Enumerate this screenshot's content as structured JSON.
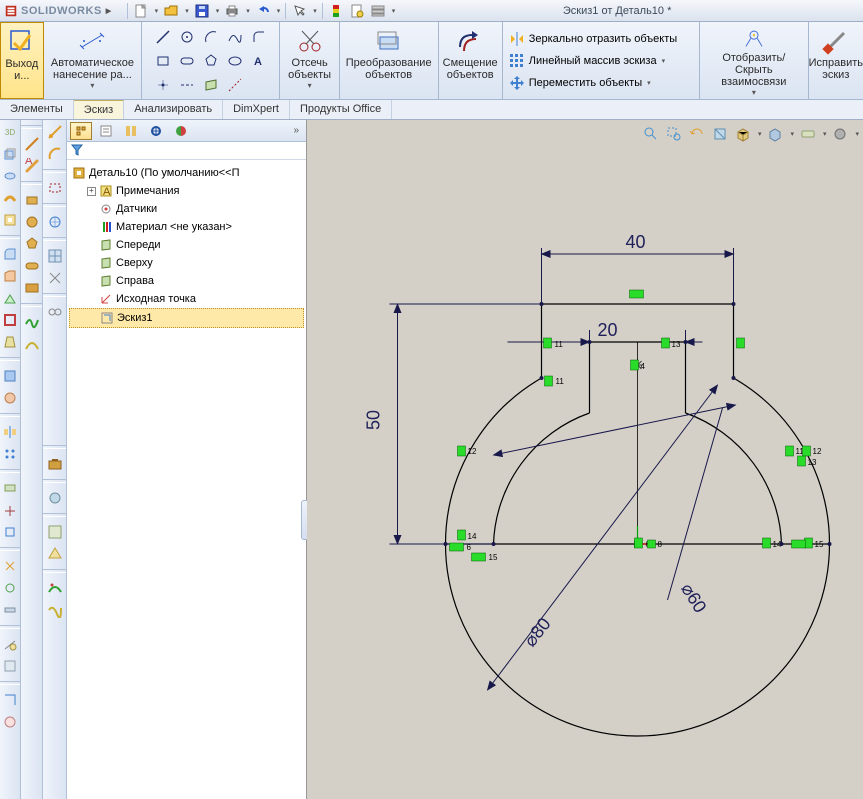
{
  "title": "Эскиз1 от Деталь10 *",
  "logo": "SOLIDWORKS",
  "ribbon": {
    "exit": "Выход и...",
    "autodim": "Автоматическое нанесение ра...",
    "trim": "Отсечь объекты",
    "convert": "Преобразование объектов",
    "offset": "Смещение объектов",
    "mirror": "Зеркально отразить объекты",
    "linear": "Линейный массив эскиза",
    "move": "Переместить объекты",
    "showhide": "Отобразить/Скрыть взаимосвязи",
    "fix": "Исправить эскиз"
  },
  "cmdtabs": {
    "t1": "Элементы",
    "t2": "Эскиз",
    "t3": "Анализировать",
    "t4": "DimXpert",
    "t5": "Продукты Office"
  },
  "tree": {
    "root": "Деталь10  (По умолчанию<<П",
    "n1": "Примечания",
    "n2": "Датчики",
    "n3": "Материал <не указан>",
    "n4": "Спереди",
    "n5": "Сверху",
    "n6": "Справа",
    "n7": "Исходная точка",
    "n8": "Эскиз1"
  },
  "dims": {
    "d40": "40",
    "d20": "20",
    "d50": "50",
    "d60": "⌀60",
    "d80": "⌀80"
  }
}
